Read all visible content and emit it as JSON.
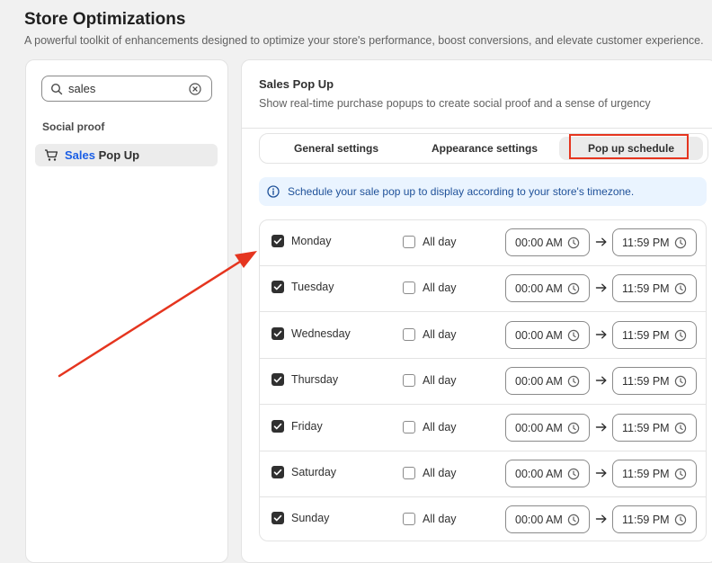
{
  "page": {
    "title": "Store Optimizations",
    "subtitle": "A powerful toolkit of enhancements designed to optimize your store's performance, boost conversions, and elevate customer experience."
  },
  "sidebar": {
    "search": {
      "value": "sales",
      "icon": "search-icon",
      "clear_icon": "clear-icon"
    },
    "section_label": "Social proof",
    "items": [
      {
        "label_match": "Sales",
        "label_rest": " Pop Up",
        "icon": "cart-icon",
        "match_color": "#1a5ee6"
      }
    ]
  },
  "card": {
    "title": "Sales Pop Up",
    "description": "Show real-time purchase popups to create social proof and a sense of urgency"
  },
  "tabs": [
    {
      "label": "General settings",
      "selected": false
    },
    {
      "label": "Appearance settings",
      "selected": false
    },
    {
      "label": "Pop up schedule",
      "selected": true
    }
  ],
  "banner": {
    "text": "Schedule your sale pop up to display according to your store's timezone.",
    "icon": "info-icon",
    "color": "#1f5199"
  },
  "schedule": {
    "all_day_label": "All day",
    "days": [
      {
        "day": "Monday",
        "enabled": true,
        "all_day": false,
        "start": "00:00 AM",
        "end": "11:59 PM"
      },
      {
        "day": "Tuesday",
        "enabled": true,
        "all_day": false,
        "start": "00:00 AM",
        "end": "11:59 PM"
      },
      {
        "day": "Wednesday",
        "enabled": true,
        "all_day": false,
        "start": "00:00 AM",
        "end": "11:59 PM"
      },
      {
        "day": "Thursday",
        "enabled": true,
        "all_day": false,
        "start": "00:00 AM",
        "end": "11:59 PM"
      },
      {
        "day": "Friday",
        "enabled": true,
        "all_day": false,
        "start": "00:00 AM",
        "end": "11:59 PM"
      },
      {
        "day": "Saturday",
        "enabled": true,
        "all_day": false,
        "start": "00:00 AM",
        "end": "11:59 PM"
      },
      {
        "day": "Sunday",
        "enabled": true,
        "all_day": false,
        "start": "00:00 AM",
        "end": "11:59 PM"
      }
    ]
  },
  "annotation": {
    "color": "#e5351f"
  }
}
